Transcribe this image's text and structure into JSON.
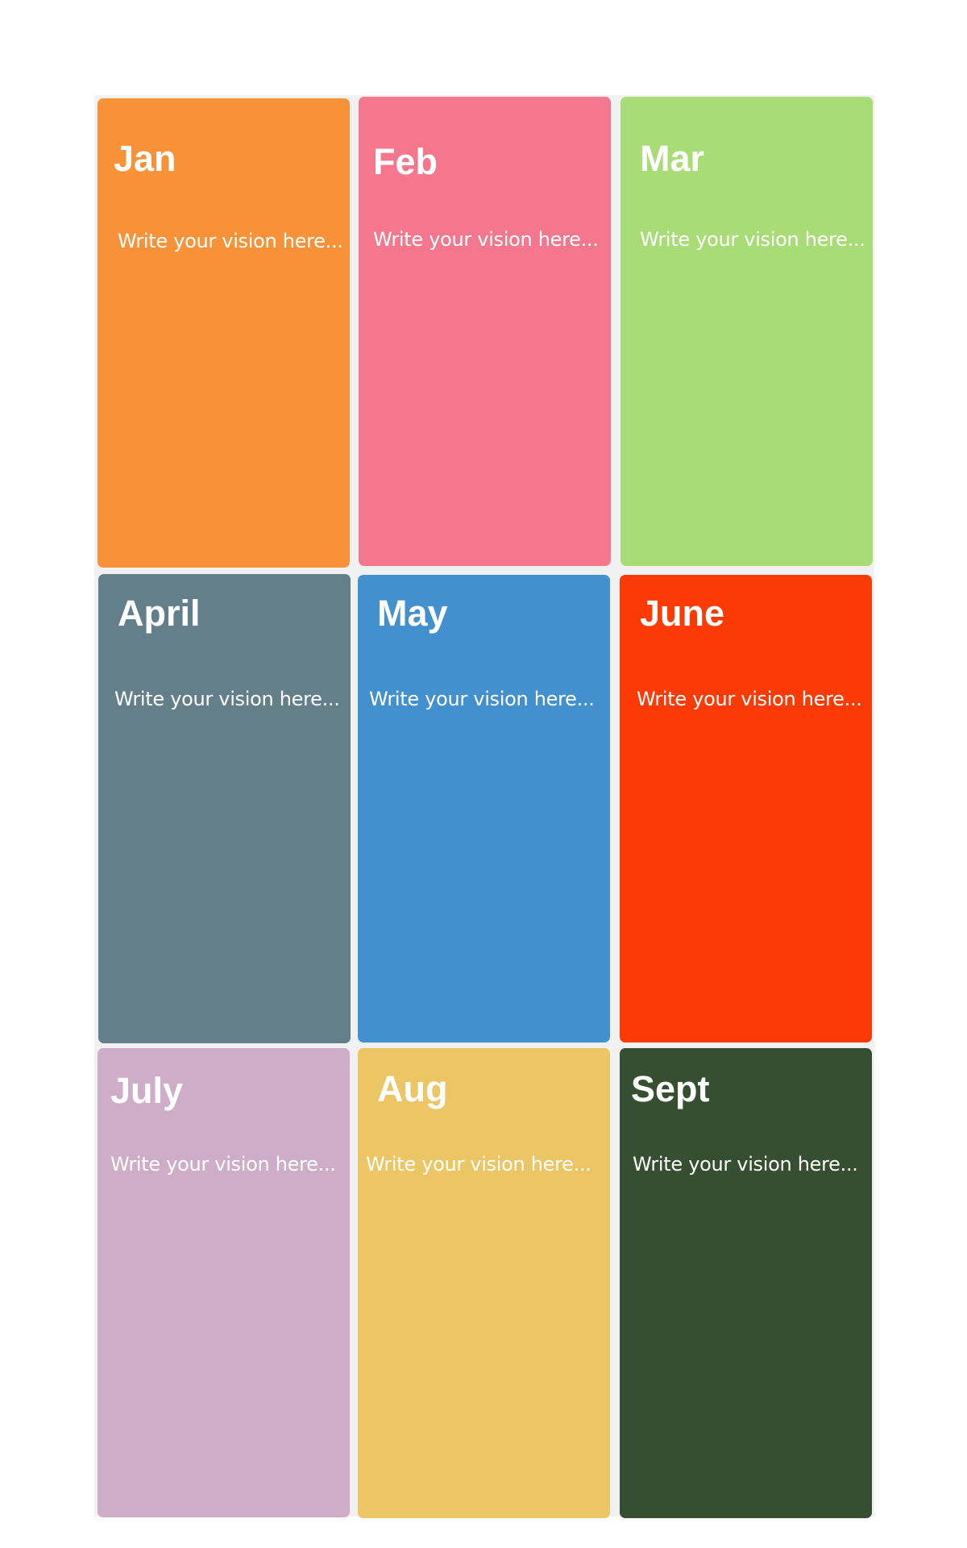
{
  "board": {
    "cards": [
      {
        "title": "Jan",
        "text": "Write your vision here...",
        "color": "#f79239"
      },
      {
        "title": "Feb",
        "text": "Write your vision here...",
        "color": "#f4778e"
      },
      {
        "title": "Mar",
        "text": "Write your vision here...",
        "color": "#a8dc76"
      },
      {
        "title": "April",
        "text": "Write your vision here...",
        "color": "#637f8a"
      },
      {
        "title": "May",
        "text": "Write your vision here...",
        "color": "#4390ce"
      },
      {
        "title": "June",
        "text": "Write your vision here...",
        "color": "#fc3a06"
      },
      {
        "title": "July",
        "text": "Write your vision here...",
        "color": "#ceadc9"
      },
      {
        "title": "Aug",
        "text": "Write your vision here...",
        "color": "#ecc564"
      },
      {
        "title": "Sept",
        "text": "Write your vision here...",
        "color": "#354f30"
      }
    ]
  }
}
